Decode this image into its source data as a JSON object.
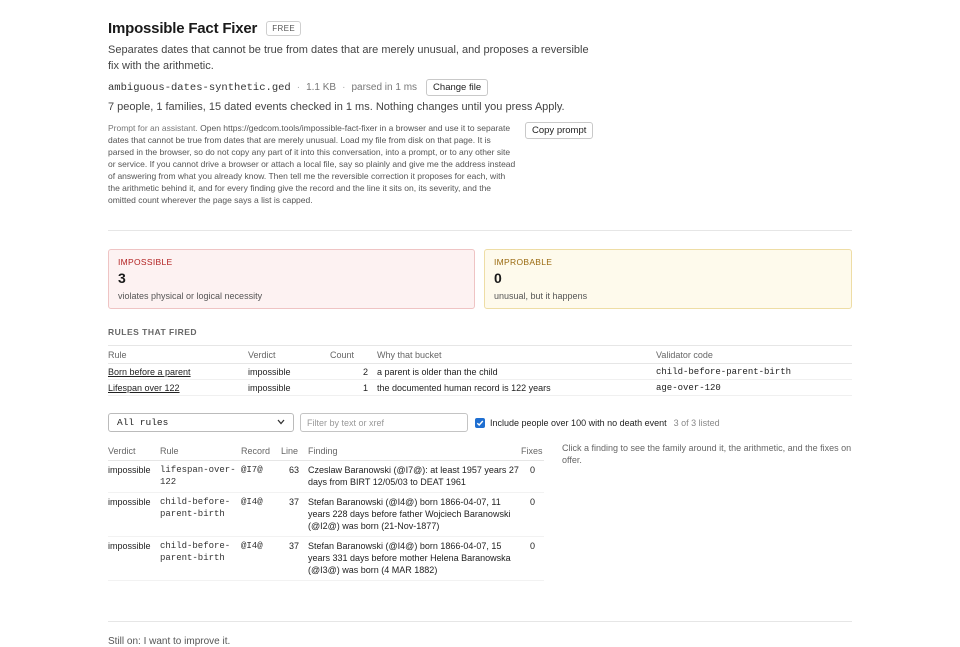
{
  "header": {
    "title": "Impossible Fact Fixer",
    "badge": "FREE",
    "description": "Separates dates that cannot be true from dates that are merely unusual, and proposes a reversible fix with the arithmetic."
  },
  "file": {
    "name": "ambiguous-dates-synthetic.ged",
    "size": "1.1 KB",
    "parsed": "parsed in 1 ms",
    "change_label": "Change file"
  },
  "summary": "7 people, 1 families, 15 dated events checked in 1 ms. Nothing changes until you press Apply.",
  "prompt": {
    "lead": "Prompt for an assistant.",
    "text": "Open https://gedcom.tools/impossible-fact-fixer in a browser and use it to separate dates that cannot be true from dates that are merely unusual. Load my file from disk on that page. It is parsed in the browser, so do not copy any part of it into this conversation, into a prompt, or to any other site or service. If you cannot drive a browser or attach a local file, say so plainly and give me the address instead of answering from what you already know. Then tell me the reversible correction it proposes for each, with the arithmetic behind it, and for every finding give the record and the line it sits on, its severity, and the omitted count wherever the page says a list is capped.",
    "copy_label": "Copy prompt"
  },
  "cards": {
    "impossible": {
      "label": "IMPOSSIBLE",
      "count": "3",
      "sub": "violates physical or logical necessity"
    },
    "improbable": {
      "label": "IMPROBABLE",
      "count": "0",
      "sub": "unusual, but it happens"
    }
  },
  "rules": {
    "heading": "RULES THAT FIRED",
    "columns": {
      "rule": "Rule",
      "verdict": "Verdict",
      "count": "Count",
      "why": "Why that bucket",
      "code": "Validator code"
    },
    "rows": [
      {
        "rule": "Born before a parent",
        "verdict": "impossible",
        "count": "2",
        "why": "a parent is older than the child",
        "code": "child-before-parent-birth"
      },
      {
        "rule": "Lifespan over 122",
        "verdict": "impossible",
        "count": "1",
        "why": "the documented human record is 122 years",
        "code": "age-over-120"
      }
    ]
  },
  "filters": {
    "select_value": "All rules",
    "search_placeholder": "Filter by text or xref",
    "checkbox_label": "Include people over 100 with no death event",
    "checkbox_checked": true,
    "listed": "3 of 3 listed"
  },
  "findings": {
    "columns": {
      "verdict": "Verdict",
      "rule": "Rule",
      "record": "Record",
      "line": "Line",
      "finding": "Finding",
      "fixes": "Fixes"
    },
    "rows": [
      {
        "verdict": "impossible",
        "rule": "lifespan-over-122",
        "record": "@I7@",
        "line": "63",
        "finding": "Czeslaw Baranowski (@I7@): at least 1957 years 27 days from BIRT 12/05/03 to DEAT 1961",
        "fixes": "0"
      },
      {
        "verdict": "impossible",
        "rule": "child-before-parent-birth",
        "record": "@I4@",
        "line": "37",
        "finding": "Stefan Baranowski (@I4@) born 1866-04-07, 11 years 228 days before father Wojciech Baranowski (@I2@) was born (21-Nov-1877)",
        "fixes": "0"
      },
      {
        "verdict": "impossible",
        "rule": "child-before-parent-birth",
        "record": "@I4@",
        "line": "37",
        "finding": "Stefan Baranowski (@I4@) born 1866-04-07, 15 years 331 days before mother Helena Baranowska (@I3@) was born (4 MAR 1882)",
        "fixes": "0"
      }
    ]
  },
  "hint": "Click a finding to see the family around it, the arithmetic, and the fixes on offer.",
  "footer": "Still on: I want to improve it."
}
